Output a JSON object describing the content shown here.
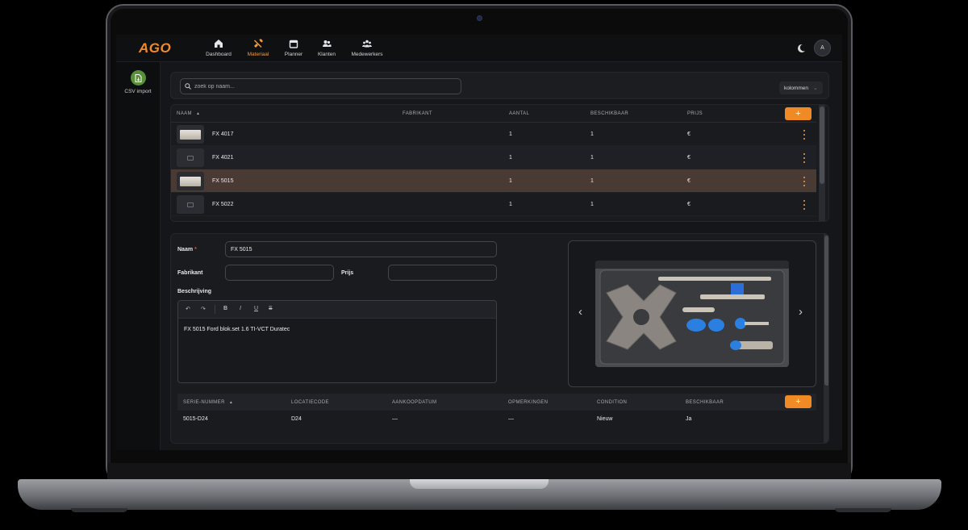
{
  "app": {
    "logo": "AGO",
    "accent": "#f08a24"
  },
  "nav": {
    "items": [
      {
        "label": "Dashboard",
        "icon": "home-icon"
      },
      {
        "label": "Materiaal",
        "icon": "tools-icon",
        "active": true
      },
      {
        "label": "Planner",
        "icon": "calendar-icon"
      },
      {
        "label": "Klanten",
        "icon": "users-icon"
      },
      {
        "label": "Medewerkers",
        "icon": "team-icon"
      }
    ],
    "theme_icon": "moon-icon",
    "avatar_initial": "A"
  },
  "sidebar": {
    "csv_import_label": "CSV import",
    "csv_icon": "file-import-icon"
  },
  "search": {
    "placeholder": "zoek op naam...",
    "value": "",
    "columns_label": "kolommen"
  },
  "items_table": {
    "columns": [
      "NAAM",
      "FABRIKANT",
      "AANTAL",
      "BESCHIKBAAR",
      "PRIJS"
    ],
    "sort_indicator": "▲",
    "add_label": "+",
    "rows": [
      {
        "name": "FX 4017",
        "fabrikant": "",
        "aantal": "1",
        "beschikbaar": "1",
        "prijs": "€",
        "thumb": "photo"
      },
      {
        "name": "FX 4021",
        "fabrikant": "",
        "aantal": "1",
        "beschikbaar": "1",
        "prijs": "€",
        "thumb": "placeholder"
      },
      {
        "name": "FX 5015",
        "fabrikant": "",
        "aantal": "1",
        "beschikbaar": "1",
        "prijs": "€",
        "thumb": "photo",
        "selected": true
      },
      {
        "name": "FX 5022",
        "fabrikant": "",
        "aantal": "1",
        "beschikbaar": "1",
        "prijs": "€",
        "thumb": "placeholder"
      }
    ]
  },
  "detail": {
    "naam_label": "Naam",
    "required_mark": "*",
    "naam_value": "FX 5015",
    "fabrikant_label": "Fabrikant",
    "fabrikant_value": "",
    "prijs_label": "Prijs",
    "prijs_value": "",
    "beschrijving_label": "Beschrijving",
    "editor": {
      "undo": "↶",
      "redo": "↷",
      "bold": "B",
      "italic": "I",
      "underline": "U",
      "strike": "S",
      "text": "FX 5015 Ford blok.set 1.6 TI-VCT Duratec"
    },
    "carousel": {
      "prev": "‹",
      "next": "›"
    }
  },
  "serial_table": {
    "columns": [
      "SERIE-NUMMER",
      "LOCATIECODE",
      "AANKOOPDATUM",
      "OPMERKINGEN",
      "CONDITION",
      "BESCHIKBAAR"
    ],
    "sort_indicator": "▲",
    "add_label": "+",
    "rows": [
      {
        "serie": "5015-D24",
        "locatie": "D24",
        "datum": "—",
        "opmerkingen": "—",
        "condition": "Nieuw",
        "beschikbaar": "Ja"
      }
    ]
  }
}
